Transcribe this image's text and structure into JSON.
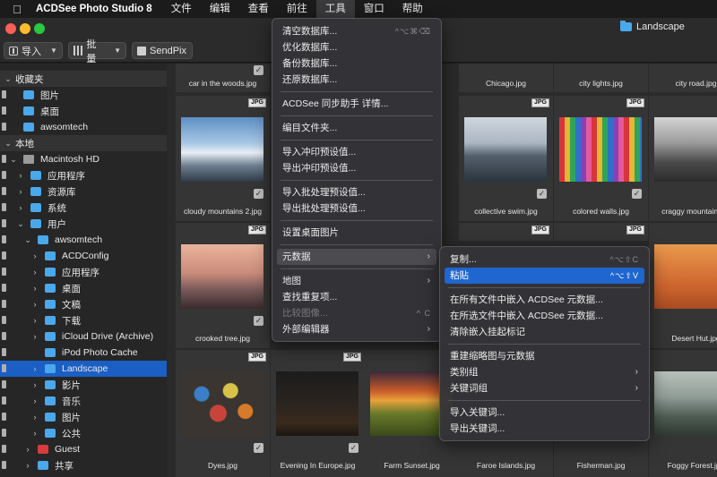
{
  "menubar": {
    "app_name": "ACDSee Photo Studio 8",
    "items": [
      "文件",
      "编辑",
      "查看",
      "前往",
      "工具",
      "窗口",
      "帮助"
    ]
  },
  "window": {
    "title": "Landscape"
  },
  "toolbar": {
    "import_label": "导入",
    "batch_label": "批量",
    "sendpix_label": "SendPix"
  },
  "sidebar": {
    "favorites_header": "收藏夹",
    "favorites": [
      "图片",
      "桌面",
      "awsomtech"
    ],
    "local_header": "本地",
    "tree": [
      "Macintosh HD",
      "应用程序",
      "资源库",
      "系统",
      "用户",
      "awsomtech",
      "ACDConfig",
      "应用程序",
      "桌面",
      "文稿",
      "下载",
      "iCloud Drive (Archive)",
      "iPod Photo Cache",
      "Landscape",
      "影片",
      "音乐",
      "图片",
      "公共",
      "Guest",
      "共享"
    ]
  },
  "grid": {
    "row0_captions": [
      "car in the woods.jpg",
      "",
      "",
      "Chicago.jpg",
      "city lights.jpg",
      "city road.jpg"
    ],
    "row1_captions": [
      "cloudy mountains 2.jpg",
      "",
      "",
      "collective swim.jpg",
      "colored walls.jpg",
      "craggy mountain.jpg"
    ],
    "row2_captions": [
      "crooked tree.jpg",
      "",
      "",
      "",
      "",
      "Desert Hut.jpg"
    ],
    "row3_captions": [
      "Dyes.jpg",
      "Evening In Europe.jpg",
      "Farm Sunset.jpg",
      "Faroe Islands.jpg",
      "Fisherman.jpg",
      "Foggy Forest.jpg"
    ],
    "badge": "JPG"
  },
  "tools_menu": {
    "items": [
      {
        "label": "清空数据库...",
        "shortcut": "^⌥⌘⌫"
      },
      {
        "label": "优化数据库..."
      },
      {
        "label": "备份数据库..."
      },
      {
        "label": "还原数据库..."
      },
      {
        "label": "ACDSee 同步助手 详情..."
      },
      {
        "label": "编目文件夹..."
      },
      {
        "label": "导入冲印预设值..."
      },
      {
        "label": "导出冲印预设值..."
      },
      {
        "label": "导入批处理预设值..."
      },
      {
        "label": "导出批处理预设值..."
      },
      {
        "label": "设置桌面图片"
      },
      {
        "label": "元数据"
      },
      {
        "label": "地图"
      },
      {
        "label": "查找重复项..."
      },
      {
        "label": "比较图像...",
        "shortcut": "^ C"
      },
      {
        "label": "外部编辑器"
      }
    ]
  },
  "metadata_submenu": {
    "items": [
      {
        "label": "复制...",
        "shortcut": "^⌥⇧C"
      },
      {
        "label": "粘贴",
        "shortcut": "^⌥⇧V"
      },
      {
        "label": "在所有文件中嵌入 ACDSee 元数据..."
      },
      {
        "label": "在所选文件中嵌入 ACDSee 元数据..."
      },
      {
        "label": "清除嵌入挂起标记"
      },
      {
        "label": "重建缩略图与元数据"
      },
      {
        "label": "类别组"
      },
      {
        "label": "关键词组"
      },
      {
        "label": "导入关键词..."
      },
      {
        "label": "导出关键词..."
      }
    ]
  },
  "colors": {
    "selection": "#1b5fc4",
    "menu_active": "#1f66cf",
    "folder": "#4aa8ec"
  }
}
